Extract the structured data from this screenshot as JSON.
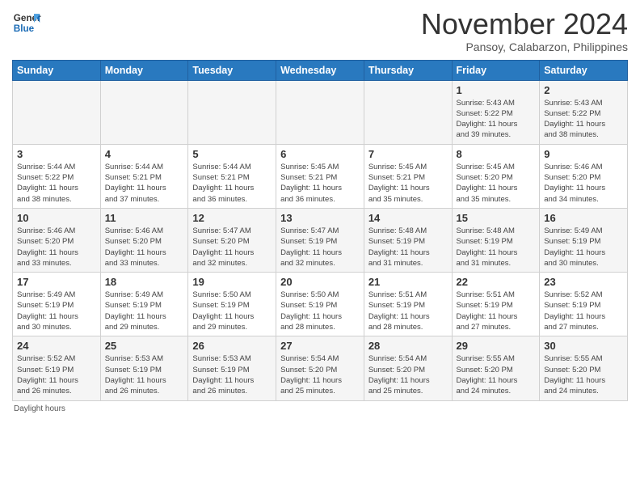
{
  "logo": {
    "line1": "General",
    "line2": "Blue"
  },
  "title": "November 2024",
  "subtitle": "Pansoy, Calabarzon, Philippines",
  "days_of_week": [
    "Sunday",
    "Monday",
    "Tuesday",
    "Wednesday",
    "Thursday",
    "Friday",
    "Saturday"
  ],
  "footer_text": "Daylight hours",
  "weeks": [
    [
      {
        "day": "",
        "info": ""
      },
      {
        "day": "",
        "info": ""
      },
      {
        "day": "",
        "info": ""
      },
      {
        "day": "",
        "info": ""
      },
      {
        "day": "",
        "info": ""
      },
      {
        "day": "1",
        "info": "Sunrise: 5:43 AM\nSunset: 5:22 PM\nDaylight: 11 hours\nand 39 minutes."
      },
      {
        "day": "2",
        "info": "Sunrise: 5:43 AM\nSunset: 5:22 PM\nDaylight: 11 hours\nand 38 minutes."
      }
    ],
    [
      {
        "day": "3",
        "info": "Sunrise: 5:44 AM\nSunset: 5:22 PM\nDaylight: 11 hours\nand 38 minutes."
      },
      {
        "day": "4",
        "info": "Sunrise: 5:44 AM\nSunset: 5:21 PM\nDaylight: 11 hours\nand 37 minutes."
      },
      {
        "day": "5",
        "info": "Sunrise: 5:44 AM\nSunset: 5:21 PM\nDaylight: 11 hours\nand 36 minutes."
      },
      {
        "day": "6",
        "info": "Sunrise: 5:45 AM\nSunset: 5:21 PM\nDaylight: 11 hours\nand 36 minutes."
      },
      {
        "day": "7",
        "info": "Sunrise: 5:45 AM\nSunset: 5:21 PM\nDaylight: 11 hours\nand 35 minutes."
      },
      {
        "day": "8",
        "info": "Sunrise: 5:45 AM\nSunset: 5:20 PM\nDaylight: 11 hours\nand 35 minutes."
      },
      {
        "day": "9",
        "info": "Sunrise: 5:46 AM\nSunset: 5:20 PM\nDaylight: 11 hours\nand 34 minutes."
      }
    ],
    [
      {
        "day": "10",
        "info": "Sunrise: 5:46 AM\nSunset: 5:20 PM\nDaylight: 11 hours\nand 33 minutes."
      },
      {
        "day": "11",
        "info": "Sunrise: 5:46 AM\nSunset: 5:20 PM\nDaylight: 11 hours\nand 33 minutes."
      },
      {
        "day": "12",
        "info": "Sunrise: 5:47 AM\nSunset: 5:20 PM\nDaylight: 11 hours\nand 32 minutes."
      },
      {
        "day": "13",
        "info": "Sunrise: 5:47 AM\nSunset: 5:19 PM\nDaylight: 11 hours\nand 32 minutes."
      },
      {
        "day": "14",
        "info": "Sunrise: 5:48 AM\nSunset: 5:19 PM\nDaylight: 11 hours\nand 31 minutes."
      },
      {
        "day": "15",
        "info": "Sunrise: 5:48 AM\nSunset: 5:19 PM\nDaylight: 11 hours\nand 31 minutes."
      },
      {
        "day": "16",
        "info": "Sunrise: 5:49 AM\nSunset: 5:19 PM\nDaylight: 11 hours\nand 30 minutes."
      }
    ],
    [
      {
        "day": "17",
        "info": "Sunrise: 5:49 AM\nSunset: 5:19 PM\nDaylight: 11 hours\nand 30 minutes."
      },
      {
        "day": "18",
        "info": "Sunrise: 5:49 AM\nSunset: 5:19 PM\nDaylight: 11 hours\nand 29 minutes."
      },
      {
        "day": "19",
        "info": "Sunrise: 5:50 AM\nSunset: 5:19 PM\nDaylight: 11 hours\nand 29 minutes."
      },
      {
        "day": "20",
        "info": "Sunrise: 5:50 AM\nSunset: 5:19 PM\nDaylight: 11 hours\nand 28 minutes."
      },
      {
        "day": "21",
        "info": "Sunrise: 5:51 AM\nSunset: 5:19 PM\nDaylight: 11 hours\nand 28 minutes."
      },
      {
        "day": "22",
        "info": "Sunrise: 5:51 AM\nSunset: 5:19 PM\nDaylight: 11 hours\nand 27 minutes."
      },
      {
        "day": "23",
        "info": "Sunrise: 5:52 AM\nSunset: 5:19 PM\nDaylight: 11 hours\nand 27 minutes."
      }
    ],
    [
      {
        "day": "24",
        "info": "Sunrise: 5:52 AM\nSunset: 5:19 PM\nDaylight: 11 hours\nand 26 minutes."
      },
      {
        "day": "25",
        "info": "Sunrise: 5:53 AM\nSunset: 5:19 PM\nDaylight: 11 hours\nand 26 minutes."
      },
      {
        "day": "26",
        "info": "Sunrise: 5:53 AM\nSunset: 5:19 PM\nDaylight: 11 hours\nand 26 minutes."
      },
      {
        "day": "27",
        "info": "Sunrise: 5:54 AM\nSunset: 5:20 PM\nDaylight: 11 hours\nand 25 minutes."
      },
      {
        "day": "28",
        "info": "Sunrise: 5:54 AM\nSunset: 5:20 PM\nDaylight: 11 hours\nand 25 minutes."
      },
      {
        "day": "29",
        "info": "Sunrise: 5:55 AM\nSunset: 5:20 PM\nDaylight: 11 hours\nand 24 minutes."
      },
      {
        "day": "30",
        "info": "Sunrise: 5:55 AM\nSunset: 5:20 PM\nDaylight: 11 hours\nand 24 minutes."
      }
    ]
  ]
}
